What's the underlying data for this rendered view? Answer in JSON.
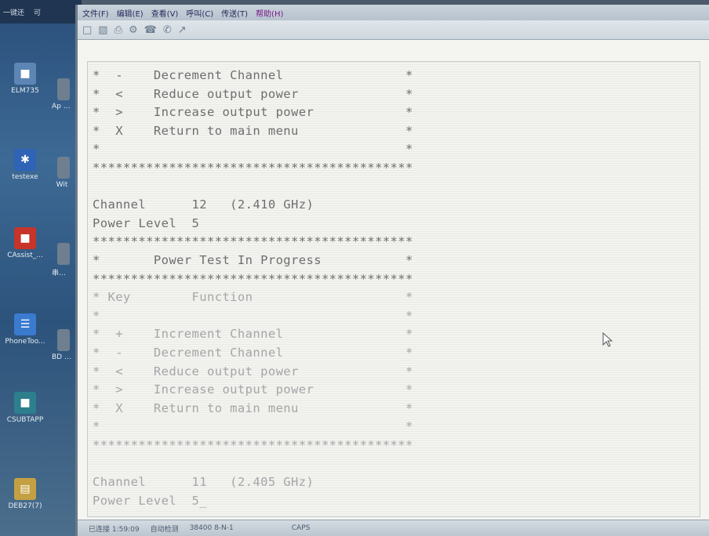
{
  "desktop": {
    "icons": [
      {
        "label": "ELM735",
        "icon": "app-icon",
        "color": "#5d86b5"
      },
      {
        "label": "testexe",
        "icon": "bluetooth-icon",
        "color": "#2f63b6"
      },
      {
        "label": "CAssist_...",
        "icon": "app-icon",
        "color": "#c6342a"
      },
      {
        "label": "PhoneToo...",
        "icon": "calculator-icon",
        "color": "#3a7bd0"
      },
      {
        "label": "CSUBTAPP",
        "icon": "app-icon",
        "color": "#2d7f8d"
      },
      {
        "label": "DEB27(7)",
        "icon": "document-icon",
        "color": "#c4a043"
      }
    ],
    "icons_col2": [
      {
        "label": "Ap RF",
        "color": "#6f7f90"
      },
      {
        "label": "Wit",
        "color": "#6f7f90"
      },
      {
        "label": "串口 助手",
        "color": "#6f7f90"
      },
      {
        "label": "BD US",
        "color": "#6f7f90"
      }
    ],
    "top_labels": [
      "一键还",
      "可"
    ]
  },
  "window": {
    "menu": [
      "文件(F)",
      "编辑(E)",
      "查看(V)",
      "呼叫(C)",
      "传送(T)",
      "帮助(H)"
    ],
    "toolbar_icons": [
      "new-icon",
      "open-icon",
      "print-icon",
      "properties-icon",
      "connect-icon",
      "disconnect-icon",
      "send-icon"
    ]
  },
  "terminal": {
    "lines": [
      {
        "text": "*  -    Decrement Channel                *",
        "faded": false
      },
      {
        "text": "*  <    Reduce output power              *",
        "faded": false
      },
      {
        "text": "*  >    Increase output power            *",
        "faded": false
      },
      {
        "text": "*  X    Return to main menu              *",
        "faded": false
      },
      {
        "text": "*                                        *",
        "faded": false
      },
      {
        "text": "******************************************",
        "faded": false
      },
      {
        "text": "",
        "faded": false
      },
      {
        "text": "Channel      12   (2.410 GHz)",
        "faded": false
      },
      {
        "text": "Power Level  5",
        "faded": false
      },
      {
        "text": "******************************************",
        "faded": false
      },
      {
        "text": "*       Power Test In Progress           *",
        "faded": false
      },
      {
        "text": "******************************************",
        "faded": false
      },
      {
        "text": "* Key        Function                    *",
        "faded": true
      },
      {
        "text": "*                                        *",
        "faded": true
      },
      {
        "text": "*  +    Increment Channel                *",
        "faded": true
      },
      {
        "text": "*  -    Decrement Channel                *",
        "faded": true
      },
      {
        "text": "*  <    Reduce output power              *",
        "faded": true
      },
      {
        "text": "*  >    Increase output power            *",
        "faded": true
      },
      {
        "text": "*  X    Return to main menu              *",
        "faded": true
      },
      {
        "text": "*                                        *",
        "faded": true
      },
      {
        "text": "******************************************",
        "faded": true
      },
      {
        "text": "",
        "faded": true
      },
      {
        "text": "Channel      11   (2.405 GHz)",
        "faded": true
      },
      {
        "text": "Power Level  5_",
        "faded": true
      }
    ]
  },
  "status": {
    "connection": "已连接 1:59:09",
    "detect": "自动检测",
    "port": "38400 8-N-1",
    "caps": "CAPS"
  }
}
